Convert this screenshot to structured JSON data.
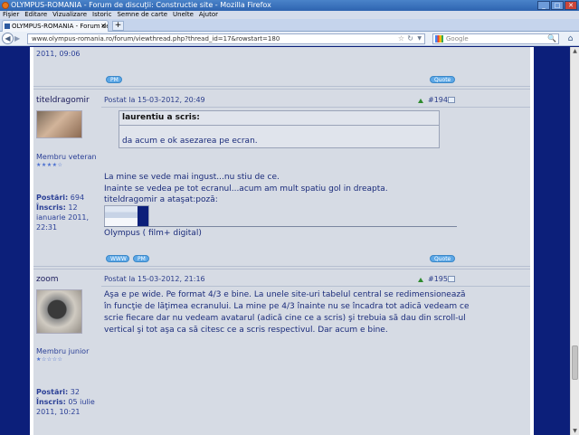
{
  "window": {
    "title": "OLYMPUS-ROMANIA - Forum de discuţii: Constructie site - Mozilla Firefox",
    "min": "_",
    "max": "□",
    "close": "✕"
  },
  "menu": [
    "Fişier",
    "Editare",
    "Vizualizare",
    "Istoric",
    "Semne de carte",
    "Unelte",
    "Ajutor"
  ],
  "tab": {
    "label": "OLYMPUS-ROMANIA - Forum de discuţii:...",
    "close": "✕",
    "new": "+"
  },
  "nav": {
    "url": "www.olympus-romania.ro/forum/viewthread.php?thread_id=17&rowstart=180",
    "search_placeholder": "Google",
    "back": "◀",
    "forward": "▶",
    "star": "☆",
    "reload": "↻",
    "dropdown": "▼",
    "search": "🔍",
    "home": "⌂"
  },
  "posts": {
    "prev_time": "2011, 09:06",
    "prev_pm": "PM",
    "prev_quote": "Quote",
    "p1": {
      "author": "titeldragomir",
      "header": "Postat la 15-03-2012, 20:49",
      "number": "#194",
      "rank": "Membru veteran",
      "stars": "★★★★☆",
      "posts_label": "Postări:",
      "posts_value": "694",
      "joined_label": "Înscris:",
      "joined_value": "12 ianuarie 2011, 22:31",
      "joined_l1": "12",
      "joined_l2": "ianuarie 2011,",
      "joined_l3": "22:31",
      "quote_author": "laurentiu a scris:",
      "quote_text": "da acum e ok asezarea pe ecran.",
      "line1": "La mine se vede mai ingust...nu stiu de ce.",
      "line2": "Inainte se vedea pe tot ecranul...acum am mult spatiu gol in dreapta.",
      "line3": "titeldragomir a ataşat:poză:",
      "signature": "Olympus ( film+ digital)",
      "www": "WWW",
      "pm": "PM",
      "quote": "Quote"
    },
    "p2": {
      "author": "zoom",
      "header": "Postat la 15-03-2012, 21:16",
      "number": "#195",
      "rank": "Membru junior",
      "stars": "★☆☆☆☆",
      "posts_label": "Postări:",
      "posts_value": "32",
      "joined_label": "Înscris:",
      "joined_value": "05 iulie 2011, 10:21",
      "joined_l1": "05 iulie",
      "joined_l2": "2011, 10:21",
      "l1": "Aşa e pe wide. Pe format 4/3 e bine. La unele site-uri tabelul central se redimensionează",
      "l2": "în funcţie de lăţimea ecranului. La mine pe 4/3 înainte nu se încadra tot adică vedeam ce",
      "l3": "scrie fiecare dar nu vedeam avatarul (adică cine ce a scris) şi trebuia să dau din scroll-ul",
      "l4": "vertical şi tot aşa ca să citesc ce a scris respectivul. Dar acum e bine."
    }
  }
}
